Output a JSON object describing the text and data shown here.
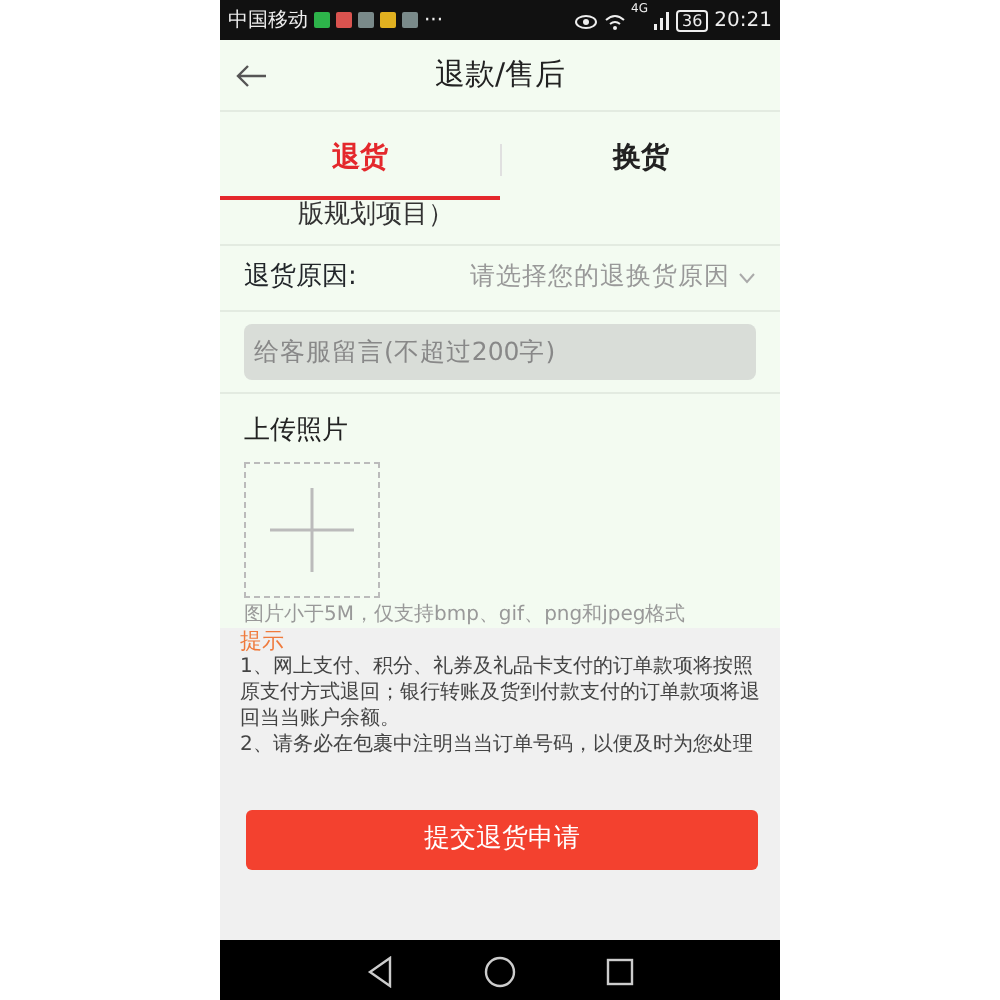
{
  "status_bar": {
    "carrier": "中国移动",
    "app_icons": [
      {
        "color": "#2db34a"
      },
      {
        "color": "#d9534f"
      },
      {
        "color": "#7a8a8a"
      },
      {
        "color": "#e0b020"
      },
      {
        "color": "#7a8a8a"
      }
    ],
    "more": "···",
    "network": "4G",
    "battery": "36",
    "time": "20:21"
  },
  "header": {
    "title": "退款/售后"
  },
  "tabs": [
    {
      "label": "退货",
      "selected": true
    },
    {
      "label": "换货",
      "selected": false
    }
  ],
  "product": {
    "name_tail": "版规划项目）"
  },
  "reason": {
    "label": "退货原因:",
    "placeholder": "请选择您的退换货原因"
  },
  "message": {
    "placeholder": "给客服留言(不超过200字)"
  },
  "upload": {
    "label": "上传照片",
    "hint": "图片小于5M，仅支持bmp、gif、png和jpeg格式"
  },
  "tips": {
    "title": "提示",
    "lines": [
      "1、网上支付、积分、礼券及礼品卡支付的订单款项将按照原支付方式退回；银行转账及货到付款支付的订单款项将退回当当账户余额。",
      "2、请务必在包裹中注明当当订单号码，以便及时为您处理"
    ]
  },
  "submit": {
    "label": "提交退货申请"
  }
}
